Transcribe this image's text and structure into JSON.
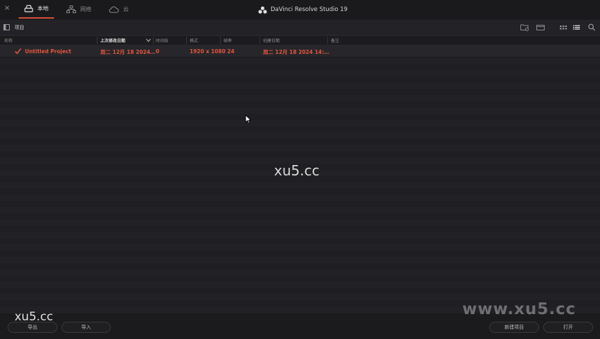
{
  "window": {
    "title": "DaVinci Resolve Studio 19",
    "close_glyph": "✕"
  },
  "tabs": [
    {
      "label": "本地",
      "icon": "local-drive-icon",
      "active": true
    },
    {
      "label": "网络",
      "icon": "network-icon",
      "active": false
    },
    {
      "label": "云",
      "icon": "cloud-icon",
      "active": false
    }
  ],
  "toolbar": {
    "label": "项目"
  },
  "columns": {
    "name": "名称",
    "modified": "上次修改日期",
    "timelines": "时间线",
    "format": "格式",
    "framerate": "帧率",
    "created": "创建日期",
    "notes": "备注"
  },
  "rows": [
    {
      "name": "Untitled Project",
      "modified": "周二 12月 18 2024…",
      "timelines": "0",
      "format": "1920 x 1080 24",
      "created": "周二 12月 18 2024 14:…"
    }
  ],
  "buttons": {
    "export": "导出",
    "import": "导入",
    "new_project": "新建项目",
    "open": "打开"
  },
  "watermarks": {
    "center": "xu5.cc",
    "left": "xu5.cc",
    "right": "www.xu5.cc"
  },
  "colors": {
    "accent": "#d8503c",
    "highlight_text": "#e1543e",
    "background": "#1f1f23"
  }
}
